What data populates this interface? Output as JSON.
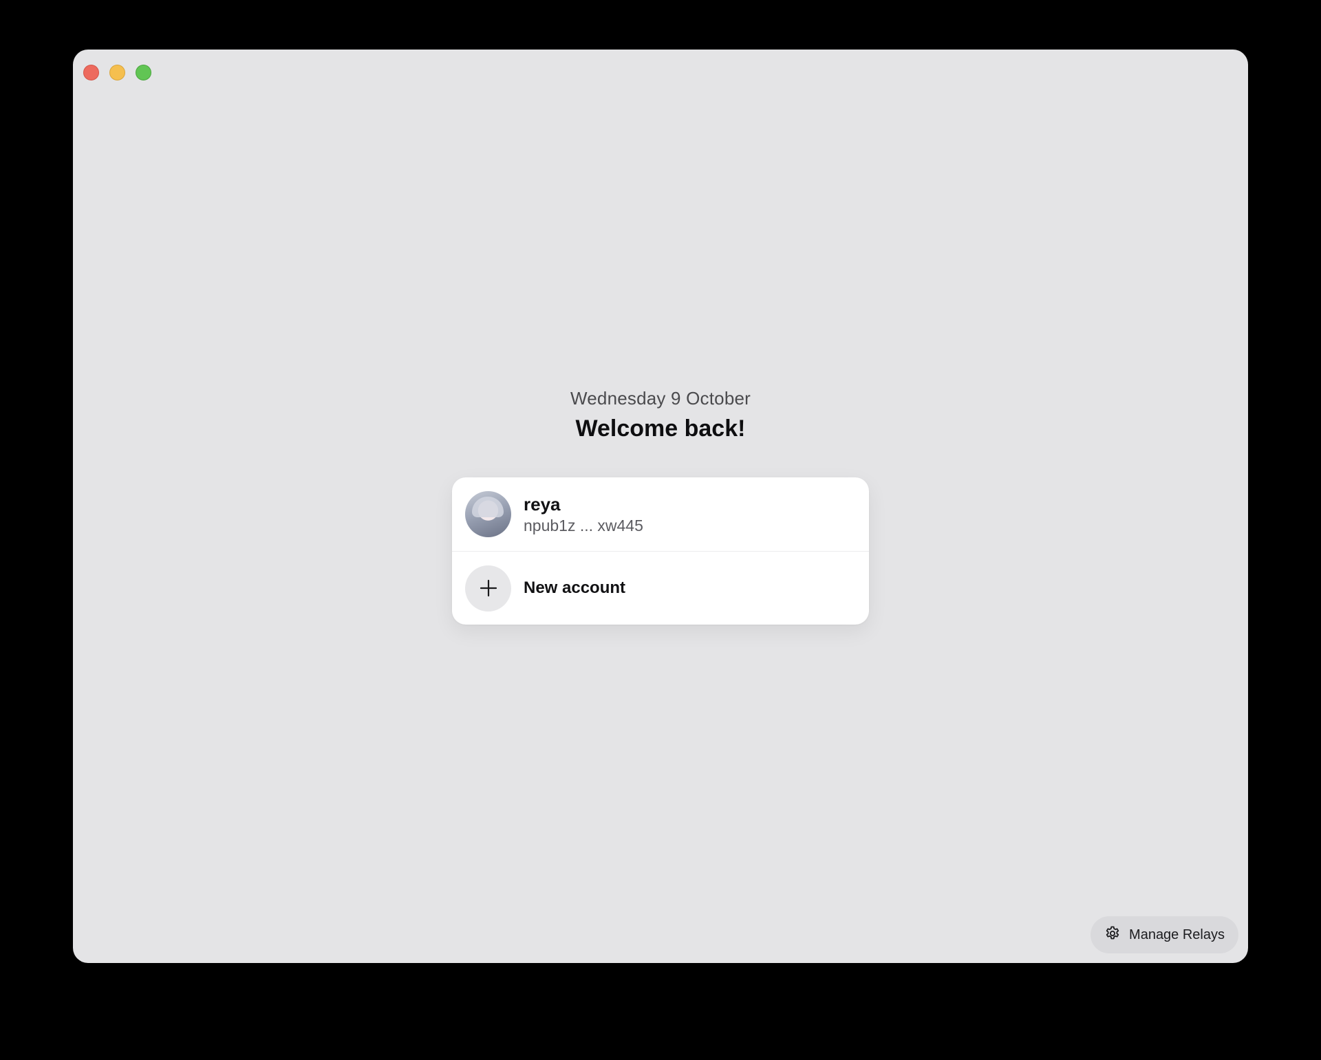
{
  "window": {
    "controls": [
      "close",
      "minimize",
      "maximize"
    ]
  },
  "header": {
    "date": "Wednesday 9 October",
    "title": "Welcome back!"
  },
  "accounts": [
    {
      "name": "reya",
      "npub": "npub1z ... xw445",
      "avatar": "avatar-image"
    }
  ],
  "new_account": {
    "label": "New account",
    "icon": "plus-icon"
  },
  "footer": {
    "relays_label": "Manage Relays",
    "relays_icon": "gear-icon"
  },
  "colors": {
    "window_bg": "#e4e4e6",
    "card_bg": "#ffffff",
    "close": "#ed6a5e",
    "minimize": "#f5bf4f",
    "maximize": "#61c554"
  }
}
